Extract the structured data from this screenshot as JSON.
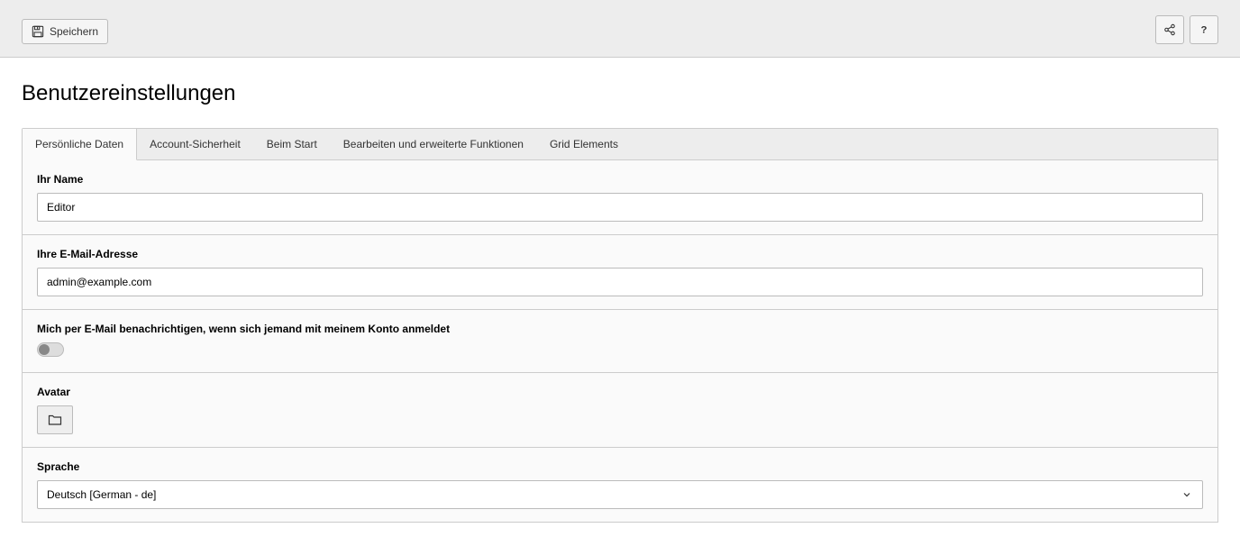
{
  "toolbar": {
    "save_label": "Speichern"
  },
  "page_title": "Benutzereinstellungen",
  "tabs": [
    {
      "label": "Persönliche Daten"
    },
    {
      "label": "Account-Sicherheit"
    },
    {
      "label": "Beim Start"
    },
    {
      "label": "Bearbeiten und erweiterte Funktionen"
    },
    {
      "label": "Grid Elements"
    }
  ],
  "form": {
    "name": {
      "label": "Ihr Name",
      "value": "Editor"
    },
    "email": {
      "label": "Ihre E-Mail-Adresse",
      "value": "admin@example.com"
    },
    "notify": {
      "label": "Mich per E-Mail benachrichtigen, wenn sich jemand mit meinem Konto anmeldet",
      "enabled": false
    },
    "avatar": {
      "label": "Avatar"
    },
    "language": {
      "label": "Sprache",
      "value": "Deutsch [German - de]"
    }
  }
}
